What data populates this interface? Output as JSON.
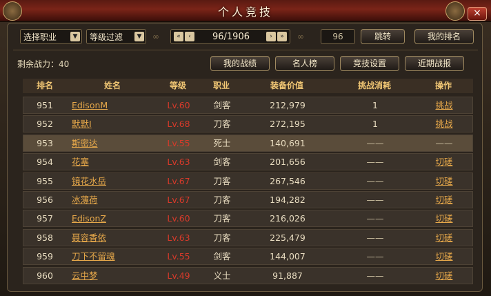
{
  "window": {
    "title": "个人竞技",
    "close": "×"
  },
  "toolbar": {
    "job_select": "选择职业",
    "level_filter": "等级过滤",
    "pager": {
      "first": "«",
      "prev": "‹",
      "pages": "96/1906",
      "next": "›",
      "last": "»"
    },
    "page_input": "96",
    "jump_button": "跳转",
    "my_rank_button": "我的排名"
  },
  "power_label": "剩余战力：40",
  "actions": {
    "my_record": "我的战绩",
    "hall_of_fame": "名人榜",
    "arena_settings": "竞技设置",
    "recent_report": "近期战报"
  },
  "table": {
    "headers": {
      "rank": "排名",
      "name": "姓名",
      "level": "等级",
      "job": "职业",
      "equip": "装备价值",
      "cost": "挑战消耗",
      "op": "操作"
    },
    "rows": [
      {
        "rank": "951",
        "name": "EdisonM",
        "level": "Lv.60",
        "job": "剑客",
        "equip": "212,979",
        "cost": "1",
        "op": "挑战"
      },
      {
        "rank": "952",
        "name": "默默I",
        "level": "Lv.68",
        "job": "刀客",
        "equip": "272,195",
        "cost": "1",
        "op": "挑战"
      },
      {
        "rank": "953",
        "name": "斯密达",
        "level": "Lv.55",
        "job": "死士",
        "equip": "140,691",
        "cost": "——",
        "op": "——"
      },
      {
        "rank": "954",
        "name": "花塞",
        "level": "Lv.63",
        "job": "剑客",
        "equip": "201,656",
        "cost": "——",
        "op": "切磋"
      },
      {
        "rank": "955",
        "name": "镜花水岳",
        "level": "Lv.67",
        "job": "刀客",
        "equip": "267,546",
        "cost": "——",
        "op": "切磋"
      },
      {
        "rank": "956",
        "name": "冰薄荷",
        "level": "Lv.67",
        "job": "刀客",
        "equip": "194,282",
        "cost": "——",
        "op": "切磋"
      },
      {
        "rank": "957",
        "name": "EdisonZ",
        "level": "Lv.60",
        "job": "刀客",
        "equip": "216,026",
        "cost": "——",
        "op": "切磋"
      },
      {
        "rank": "958",
        "name": "聂容香依",
        "level": "Lv.63",
        "job": "刀客",
        "equip": "225,479",
        "cost": "——",
        "op": "切磋"
      },
      {
        "rank": "959",
        "name": "刀下不留魂",
        "level": "Lv.55",
        "job": "剑客",
        "equip": "144,007",
        "cost": "——",
        "op": "切磋"
      },
      {
        "rank": "960",
        "name": "云中梦",
        "level": "Lv.49",
        "job": "义士",
        "equip": "91,887",
        "cost": "——",
        "op": "切磋"
      }
    ]
  }
}
